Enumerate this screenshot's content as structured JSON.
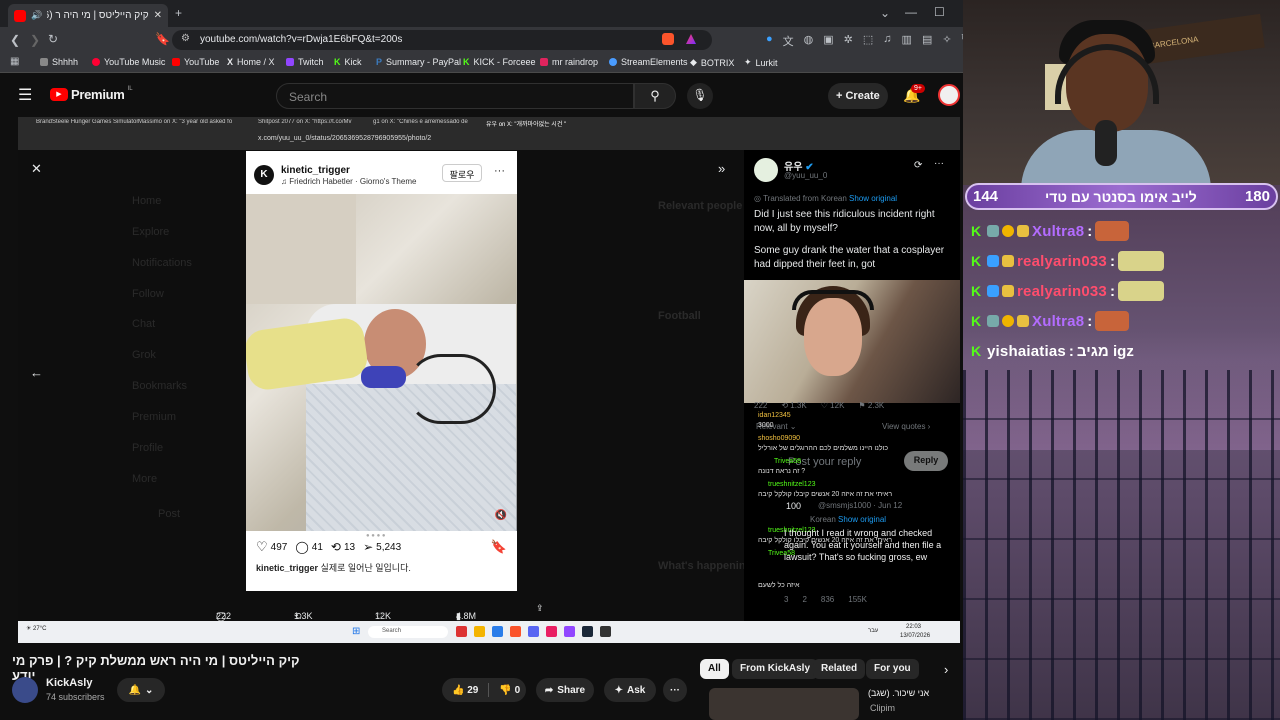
{
  "browser": {
    "tab_title": "קיק הייליטס | מי היה ר (2346)",
    "url": "youtube.com/watch?v=rDwja1E6bFQ&t=200s",
    "bookmarks": [
      "Shhhh",
      "YouTube Music",
      "YouTube",
      "Home / X",
      "Twitch",
      "Kick",
      "Summary - PayPal",
      "KICK - Forceee",
      "mr raindrop",
      "StreamElements",
      "BOTRIX",
      "Lurkit"
    ]
  },
  "youtube": {
    "logo_text": "Premium",
    "logo_region": "IL",
    "search_placeholder": "Search",
    "create_label": "Create",
    "notif_count": "9+",
    "video_title": "קיק הייליטס | מי היה ראש ממשלת קיק ? | פרק מי יודע",
    "channel_name": "KickAsly",
    "channel_subs": "74 subscribers",
    "likes": "29",
    "dislikes": "0",
    "share_label": "Share",
    "ask_label": "Ask",
    "chips": [
      "All",
      "From KickAsly",
      "Related",
      "For you"
    ],
    "next_clip_title": "אני שיכור. (שגב)",
    "next_clip_channel": "Clipim"
  },
  "inner_browser": {
    "tabs": [
      "BrandSteele Hunger Games Simulator",
      "Massimo on X: \"3 year old asked fo",
      "Shitpost 2077 on X: \"https://t.co/Mv",
      "g1 on X: \"Chinês é arremessado de",
      "유우 on X: \"개까마아없는 시건 \""
    ],
    "url": "x.com/yuu_uu_0/status/2065369528796905955/photo/2",
    "sidebar_ghost": [
      "Home",
      "Explore",
      "Notifications",
      "Follow",
      "Chat",
      "Grok",
      "Bookmarks",
      "Premium",
      "Profile",
      "More",
      "Post"
    ],
    "right_ghost": [
      "Relevant people",
      "Football",
      "What's happening"
    ]
  },
  "instagram_post": {
    "username": "kinetic_trigger",
    "song": "Friedrich Habetler · Giorno's Theme",
    "follow_label": "팔로우",
    "likes": "497",
    "comments": "41",
    "reposts": "13",
    "shares": "5,243",
    "caption_user": "kinetic_trigger",
    "caption_text": "실제로 일어난 일입니다."
  },
  "tweet": {
    "name": "유우",
    "handle": "@yuu_uu_0",
    "translated": "Translated from Korean",
    "show_original": "Show original",
    "body_1": "Did I just see this ridiculous incident right now, all by myself?",
    "body_2": "Some guy drank the water that a cosplayer had dipped their feet in, got",
    "stats": [
      "222",
      "1.3K",
      "12K",
      "2.3K"
    ],
    "relevant": "Relevant",
    "view_quotes": "View quotes",
    "reply_placeholder": "Post your reply",
    "reply_button": "Reply",
    "reply_name": "100",
    "reply_handle": "@smsmjs1000 · Jun 12",
    "reply_translated": "Korean",
    "reply_show_original": "Show original",
    "reply_body": "I thought I read it wrong and checked again. You eat it yourself and then file a lawsuit? That's so fucking gross, ew",
    "reply_stats": [
      "3",
      "2",
      "836",
      "155K"
    ]
  },
  "bottom_stats": {
    "replies": "222",
    "reposts": "1.3K",
    "likes": "12K",
    "views": "4.8M"
  },
  "overlay_chat_small": [
    {
      "user": "idan12345",
      "text": "3000"
    },
    {
      "user": "shosho09090",
      "text": "כולנו היינו משלמים לכם ההרוגלים של אורליל"
    },
    {
      "user": "Trivea58",
      "text": "זה נראה דנונה ?"
    },
    {
      "user": "trueshnitzel123",
      "text": "ראיתי את זה איזה 20 אנשים קיבלו קולקל קיבה"
    },
    {
      "user": "trueshnitzel123",
      "text": "ראיתי את זה איזה 20 אנשים קיבלו קולקל קיבה"
    },
    {
      "user": "Trivea58",
      "text": "אייכססס"
    },
    {
      "user": "",
      "text": "איזה כל לשעם"
    }
  ],
  "taskbar": {
    "weather": "27°C",
    "search": "Search",
    "time": "22:03",
    "date": "13/07/2026",
    "lang": "עבר"
  },
  "stream": {
    "score_left": "144",
    "score_right": "180",
    "live_title": "לייב אימו בסנטר עם טדי",
    "banner": "BARCELONA",
    "chat": [
      {
        "user": "Xultra8",
        "color": "#b36cff",
        "msg": ""
      },
      {
        "user": "realyarin033",
        "color": "#ff4d6d",
        "msg": ""
      },
      {
        "user": "realyarin033",
        "color": "#ff4d6d",
        "msg": ""
      },
      {
        "user": "Xultra8",
        "color": "#b36cff",
        "msg": ""
      },
      {
        "user": "yishaiatias",
        "color": "#ffffff",
        "msg": "מגיב igz"
      }
    ]
  },
  "colors": {
    "yt_bg": "#0f0f0f",
    "brand_red": "#ff0000",
    "kick_green": "#53fc18",
    "x_blue": "#1d9bf0",
    "live_purple": "#8a5cc4"
  }
}
